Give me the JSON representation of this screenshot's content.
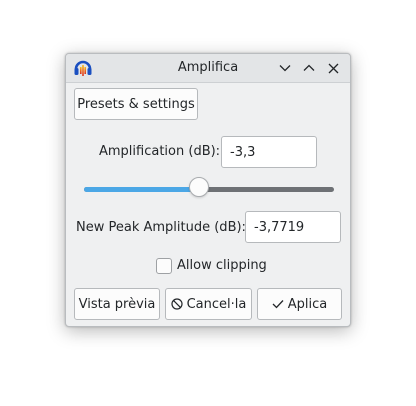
{
  "window": {
    "title": "Amplifica",
    "app_icon": "audacity-headphones-icon",
    "controls": [
      "chevron-down-icon",
      "chevron-up-icon",
      "close-icon"
    ]
  },
  "presets_button": {
    "label": "Presets & settings"
  },
  "amplification": {
    "label": "Amplification (dB):",
    "value": "-3,3"
  },
  "slider": {
    "fraction": 0.46,
    "fill_color": "#4ba7e6",
    "track_color": "#6e7175"
  },
  "peak": {
    "label": "New Peak Amplitude (dB):",
    "value": "-3,7719"
  },
  "clipping": {
    "label": "Allow clipping",
    "checked": false
  },
  "footer": {
    "preview_label": "Vista prèvia",
    "cancel_label": "Cancel·la",
    "cancel_icon": "cancel-circle-icon",
    "apply_label": "Aplica",
    "apply_icon": "checkmark-icon"
  }
}
